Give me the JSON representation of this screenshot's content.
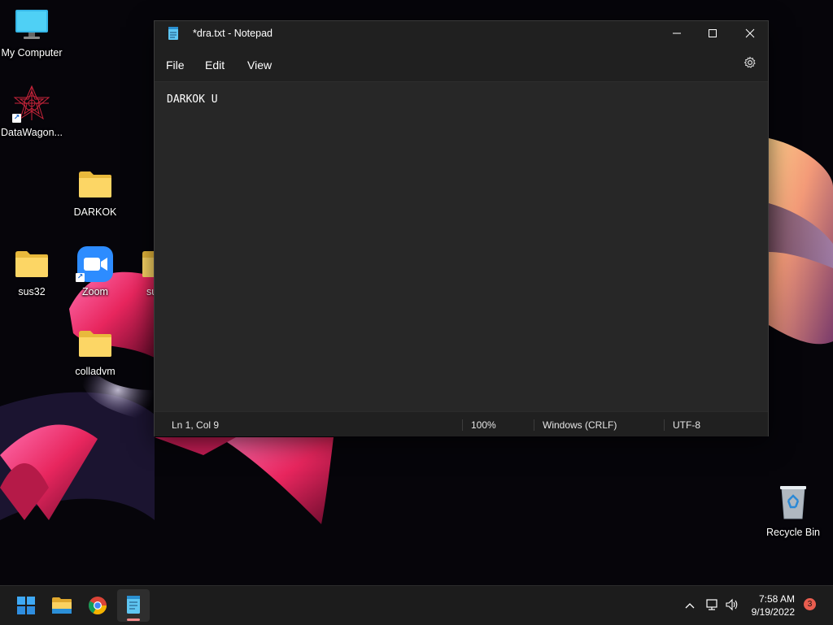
{
  "desktop": {
    "icons": {
      "my_computer": "My Computer",
      "datawagon": "DataWagon...",
      "darkok": "DARKOK",
      "sus32": "sus32",
      "zoom": "Zoom",
      "partial": "su",
      "colladvm": "colladvm",
      "recycle_bin": "Recycle Bin"
    }
  },
  "notepad": {
    "title": "*dra.txt - Notepad",
    "menu": [
      "File",
      "Edit",
      "View"
    ],
    "content": "DARKOK U",
    "status": {
      "position": "Ln 1, Col 9",
      "zoom": "100%",
      "line_ending": "Windows (CRLF)",
      "encoding": "UTF-8"
    }
  },
  "taskbar": {
    "apps": [
      "start-icon",
      "file-explorer-icon",
      "chrome-icon",
      "notepad-icon"
    ],
    "active_app": "notepad",
    "clock_time": "7:58 AM",
    "clock_date": "9/19/2022",
    "notification_count": "3"
  },
  "colors": {
    "window_bg": "#202020",
    "editor_bg": "#272727",
    "taskbar_bg": "#1c1c1c",
    "badge": "#e85d4f"
  }
}
